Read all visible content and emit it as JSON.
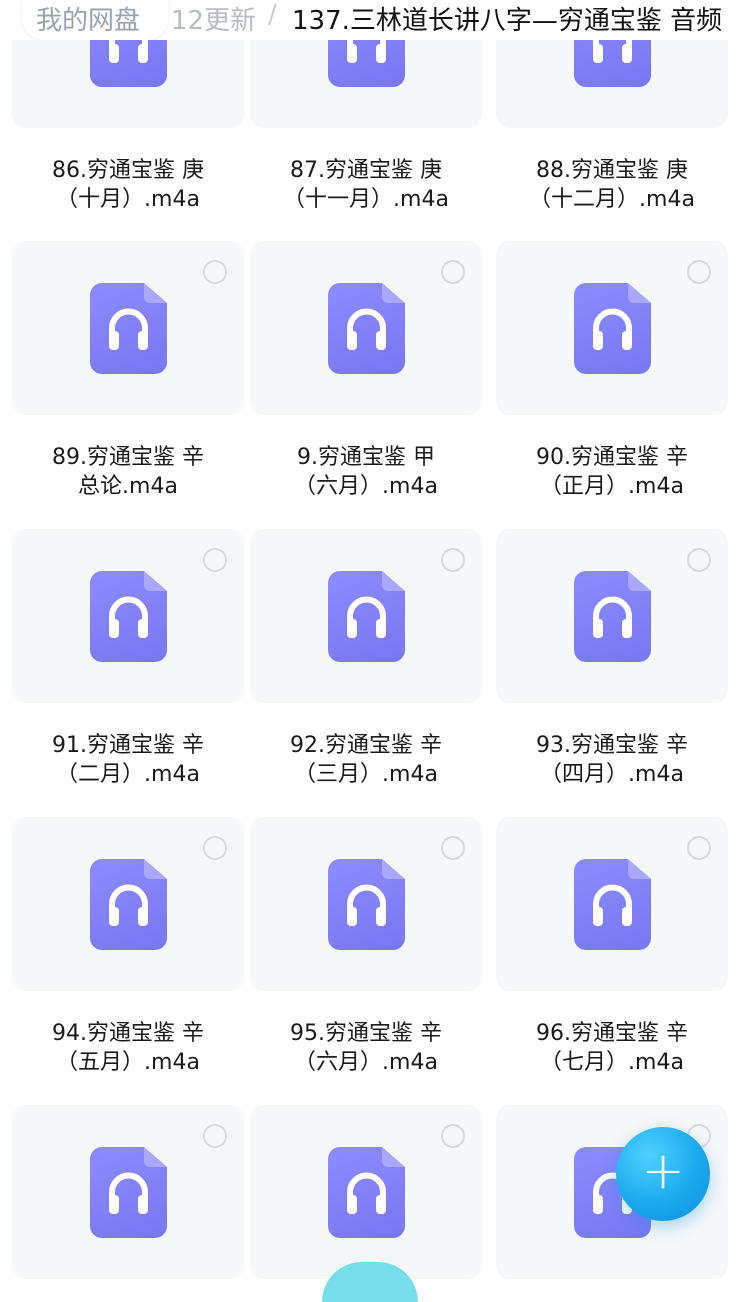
{
  "breadcrumb": {
    "home": "我的网盘",
    "level2": "12更新",
    "separator": "/",
    "current": "137.三林道长讲八字—穷通宝鉴 音频"
  },
  "files": [
    {
      "line1": "86.穷通宝鉴 庚",
      "line2": "（十月）.m4a"
    },
    {
      "line1": "87.穷通宝鉴 庚",
      "line2": "（十一月）.m4a"
    },
    {
      "line1": "88.穷通宝鉴 庚",
      "line2": "（十二月）.m4a"
    },
    {
      "line1": "89.穷通宝鉴 辛",
      "line2": "总论.m4a"
    },
    {
      "line1": "9.穷通宝鉴 甲",
      "line2": "（六月）.m4a"
    },
    {
      "line1": "90.穷通宝鉴 辛",
      "line2": "（正月）.m4a"
    },
    {
      "line1": "91.穷通宝鉴 辛",
      "line2": "（二月）.m4a"
    },
    {
      "line1": "92.穷通宝鉴 辛",
      "line2": "（三月）.m4a"
    },
    {
      "line1": "93.穷通宝鉴 辛",
      "line2": "（四月）.m4a"
    },
    {
      "line1": "94.穷通宝鉴 辛",
      "line2": "（五月）.m4a"
    },
    {
      "line1": "95.穷通宝鉴 辛",
      "line2": "（六月）.m4a"
    },
    {
      "line1": "96.穷通宝鉴 辛",
      "line2": "（七月）.m4a"
    },
    {
      "line1": "",
      "line2": ""
    },
    {
      "line1": "",
      "line2": ""
    },
    {
      "line1": "",
      "line2": ""
    }
  ],
  "icons": {
    "file": "audio-file-icon",
    "select": "select-circle-icon",
    "add": "plus-icon"
  },
  "fab": {
    "label": "+"
  },
  "colors": {
    "icon_purple": "#7f7ef7",
    "fab_blue": "#18a6ee",
    "card_bg": "#f6f7f9"
  }
}
